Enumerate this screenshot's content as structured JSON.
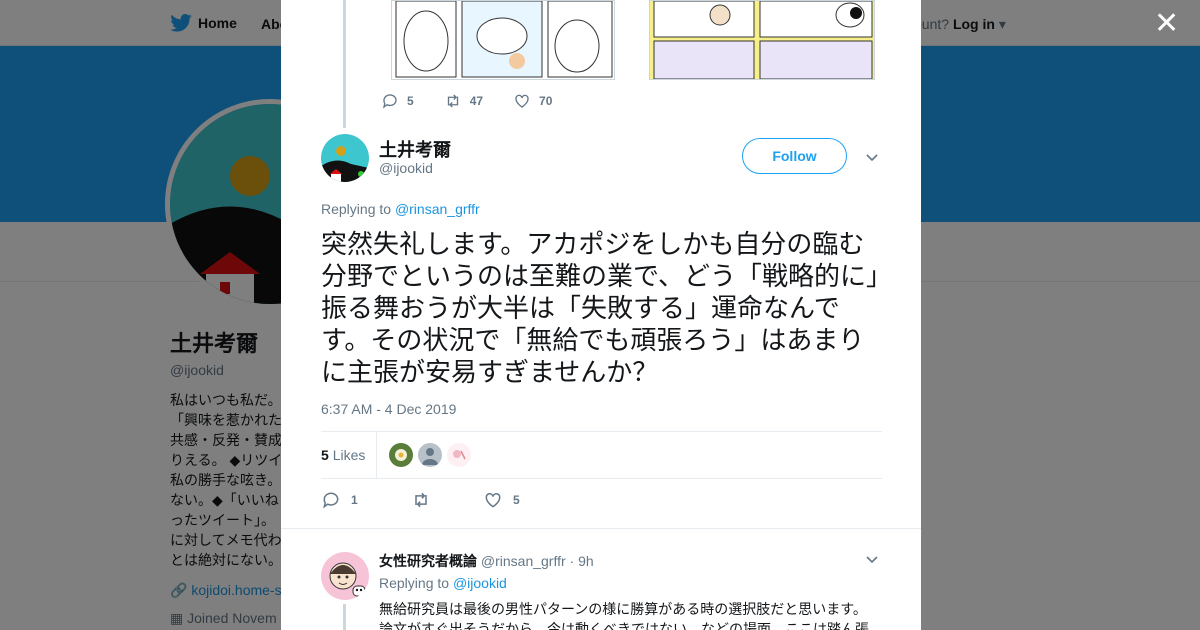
{
  "background": {
    "nav": {
      "home_label": "Home",
      "about_label": "Abo",
      "account_prompt": "ccount?",
      "login_label": "Log in"
    },
    "profile": {
      "name": "土井考爾",
      "handle": "@ijookid",
      "bio": "私はいつも私だ。「興味を惹かれた共感・反発・賛成りえる。 ◆リツイ私の勝手な呟き。ない。◆「いいねったツイート」。に対してメモ代わとは絶対にない。",
      "link": "kojidoi.home-s",
      "joined": "Joined Novem"
    },
    "colors": {
      "banner": "#1da1f2",
      "overlay": "rgba(0,0,0,0.5)"
    }
  },
  "modal": {
    "close_icon": "close-icon",
    "previous_tweet": {
      "replies": "5",
      "retweets": "47",
      "likes": "70"
    },
    "main_tweet": {
      "author_name": "土井考爾",
      "author_handle": "@ijookid",
      "follow_label": "Follow",
      "replying_prefix": "Replying to",
      "replying_to": "@rinsan_grffr",
      "text": "突然失礼します。アカポジをしかも自分の臨む分野でというのは至難の業で、どう「戦略的に」振る舞おうが大半は「失敗する」運命なんです。その状況で「無給でも頑張ろう」はあまりに主張が安易すぎませんか？",
      "timestamp": "6:37 AM - 4 Dec 2019",
      "likes_count": "5",
      "likes_label": "Likes",
      "action_replies": "1",
      "action_retweets": "",
      "action_likes": "5"
    },
    "reply_tweet": {
      "author_name": "女性研究者概論",
      "author_handle": "@rinsan_grffr",
      "time": "· 9h",
      "replying_prefix": "Replying to",
      "replying_to": "@ijookid",
      "text": "無給研究員は最後の男性パターンの様に勝算がある時の選択肢だと思います。論文がすぐ出そうだから、今は動くべきではない、などの場面。ここは踏ん張"
    }
  }
}
